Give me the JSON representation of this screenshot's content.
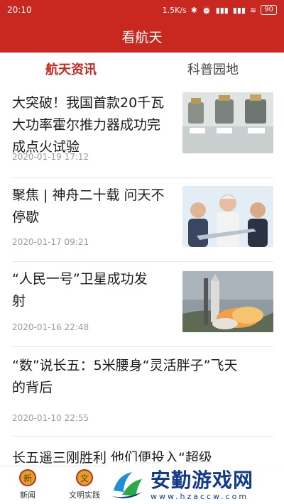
{
  "status": {
    "time": "20:10",
    "speed": "1.5K/s",
    "battery": "90"
  },
  "app": {
    "title": "看航天"
  },
  "tabs": [
    {
      "label": "航天资讯",
      "active": true
    },
    {
      "label": "科普园地",
      "active": false
    }
  ],
  "articles": [
    {
      "title_lines": [
        "大突破！我国首款20千瓦",
        "大功率霍尔推力器成功完",
        "成点火试验"
      ],
      "date": "2020-01-19 17:12",
      "thumb": "thrusters-photo-icon"
    },
    {
      "title_lines": [
        "聚焦 | 神舟二十载 问天不",
        "停歇"
      ],
      "date": "2020-01-17 09:21",
      "thumb": "scientists-photo-icon"
    },
    {
      "title_lines": [
        "“人民一号”卫星成功发",
        "射"
      ],
      "date": "2020-01-16 22:48",
      "thumb": "rocket-launch-photo-icon"
    },
    {
      "title_lines": [
        "“数”说长五：5米腰身“灵活胖子”飞天",
        "的背后"
      ],
      "date": "2020-01-10 22:55",
      "thumb": ""
    },
    {
      "title_lines": [
        "长五遥三刚胜利   他们便投入“超级"
      ],
      "date": "",
      "thumb": ""
    }
  ],
  "bottom_nav": [
    {
      "label": "新闻",
      "icon": "news-icon",
      "glyph": "新"
    },
    {
      "label": "文明实践",
      "icon": "practice-icon",
      "glyph": "文"
    }
  ],
  "watermark": {
    "text": "安勤游戏网",
    "url": "www.hzaccw.com"
  },
  "colors": {
    "brand_red": "#c8281f",
    "watermark_blue": "#123a8c"
  }
}
